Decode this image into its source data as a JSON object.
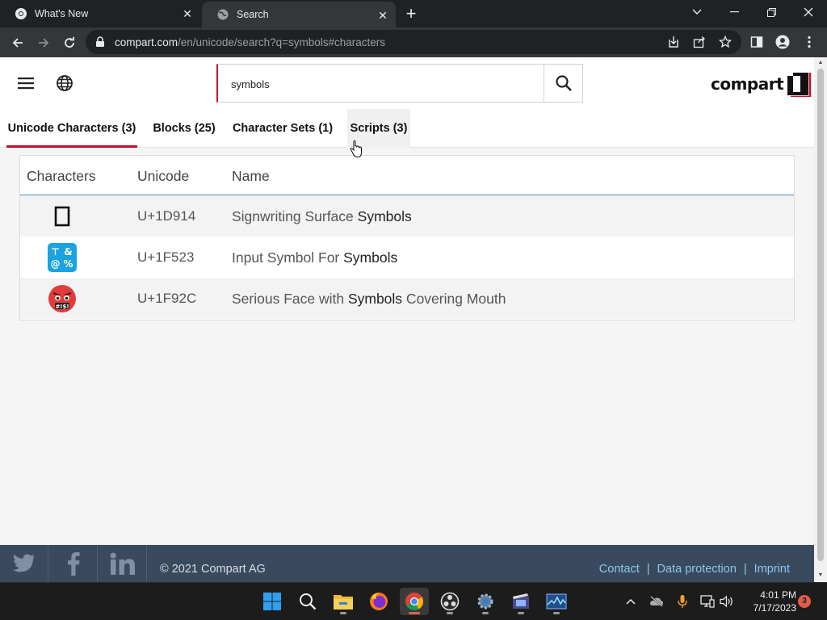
{
  "browser": {
    "tabs": [
      {
        "title": "What's New",
        "icon": "chrome-icon"
      },
      {
        "title": "Search",
        "icon": "globe-icon"
      }
    ],
    "active_tab": 1,
    "url_host": "compart.com",
    "url_rest": "/en/unicode/search?q=symbols#characters"
  },
  "site": {
    "search_value": "symbols",
    "logo_text": "compart",
    "tabs": [
      {
        "label": "Unicode Characters (3)"
      },
      {
        "label": "Blocks (25)"
      },
      {
        "label": "Character Sets (1)"
      },
      {
        "label": "Scripts (3)"
      }
    ],
    "table": {
      "headers": [
        "Characters",
        "Unicode",
        "Name"
      ],
      "rows": [
        {
          "char": "☐",
          "code": "U+1D914",
          "name_pre": "Signwriting Surface ",
          "name_match": "Symbols",
          "name_post": ""
        },
        {
          "char": "⌤",
          "code": "U+1F523",
          "name_pre": "Input Symbol For ",
          "name_match": "Symbols",
          "name_post": ""
        },
        {
          "char": "☹",
          "code": "U+1F92C",
          "name_pre": "Serious Face with ",
          "name_match": "Symbols",
          "name_post": " Covering Mouth"
        }
      ]
    },
    "footer": {
      "copyright": "© 2021 Compart AG",
      "links": [
        "Contact",
        "Data protection",
        "Imprint"
      ],
      "social": [
        "twitter-icon",
        "facebook-icon",
        "linkedin-icon"
      ]
    }
  },
  "taskbar": {
    "time": "4:01 PM",
    "date": "7/17/2023",
    "notifications": "3"
  },
  "colors": {
    "accent_red": "#c8102e",
    "header_line_blue": "#3b8fc4",
    "footer_bg": "#3a4a5e",
    "link_blue": "#8ec5ee"
  }
}
